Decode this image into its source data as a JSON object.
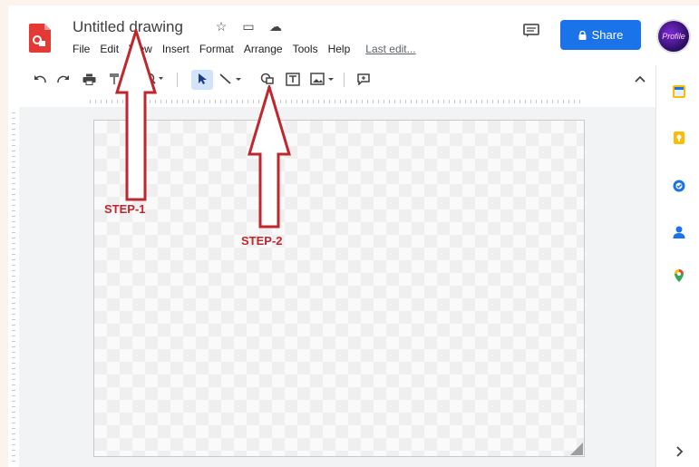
{
  "document": {
    "title": "Untitled drawing"
  },
  "menu": [
    "File",
    "Edit",
    "View",
    "Insert",
    "Format",
    "Arrange",
    "Tools",
    "Help"
  ],
  "last_edit": "Last edit...",
  "share": {
    "label": "Share"
  },
  "avatar": {
    "text": "Profile"
  },
  "toolbar_icons": [
    "undo-icon",
    "redo-icon",
    "print-icon",
    "paint-format-icon",
    "zoom-icon",
    "select-icon",
    "line-icon",
    "shape-icon",
    "text-box-icon",
    "image-icon",
    "comment-icon"
  ],
  "side_panel_icons": [
    "calendar-icon",
    "keep-icon",
    "tasks-icon",
    "contacts-icon",
    "maps-icon"
  ],
  "annotations": {
    "step1": "STEP-1",
    "step2": "STEP-2"
  },
  "colors": {
    "accent": "#1a73e8",
    "annotation": "#c0272d",
    "logo": "#e53935"
  }
}
